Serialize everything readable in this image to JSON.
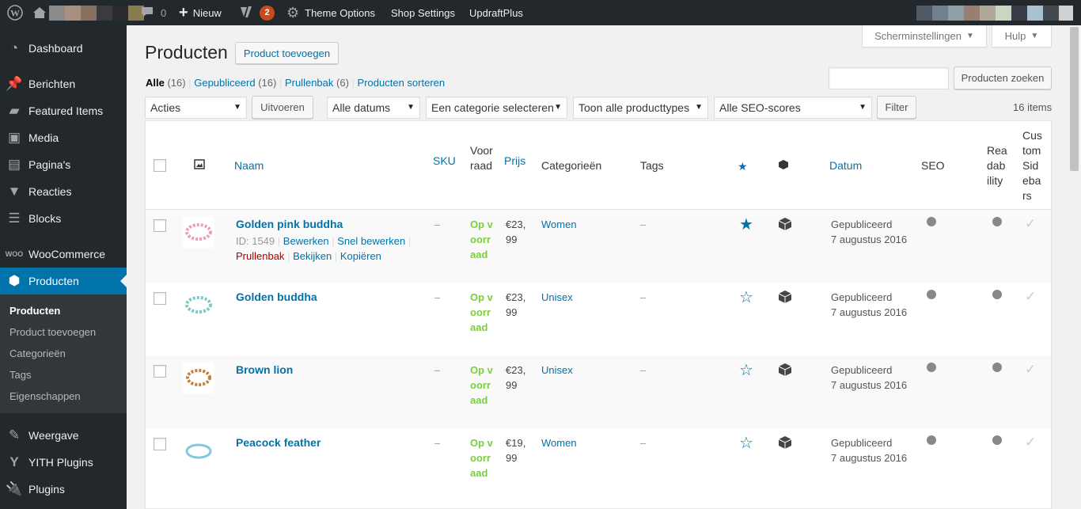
{
  "adminbar": {
    "comments_count": "0",
    "new_label": "Nieuw",
    "yoast_badge": "2",
    "theme_options": "Theme Options",
    "shop_settings": "Shop Settings",
    "updraftplus": "UpdraftPlus"
  },
  "sidebar": {
    "items": [
      {
        "label": "Dashboard",
        "icon": "dashboard-icon"
      },
      {
        "label": "Berichten",
        "icon": "pin-icon"
      },
      {
        "label": "Featured Items",
        "icon": "folder-icon"
      },
      {
        "label": "Media",
        "icon": "media-icon"
      },
      {
        "label": "Pagina's",
        "icon": "page-icon"
      },
      {
        "label": "Reacties",
        "icon": "comment-icon"
      },
      {
        "label": "Blocks",
        "icon": "blocks-icon"
      },
      {
        "label": "WooCommerce",
        "icon": "woocommerce-icon"
      },
      {
        "label": "Producten",
        "icon": "product-icon"
      },
      {
        "label": "Weergave",
        "icon": "brush-icon"
      },
      {
        "label": "YITH Plugins",
        "icon": "yith-icon"
      },
      {
        "label": "Plugins",
        "icon": "plugin-icon"
      }
    ],
    "submenu": [
      "Producten",
      "Product toevoegen",
      "Categorieën",
      "Tags",
      "Eigenschappen"
    ]
  },
  "screen_options": "Scherminstellingen",
  "help": "Hulp",
  "page_title": "Producten",
  "add_product": "Product toevoegen",
  "filters": {
    "all": "Alle",
    "all_count": "(16)",
    "published": "Gepubliceerd",
    "published_count": "(16)",
    "trash": "Prullenbak",
    "trash_count": "(6)",
    "sort": "Producten sorteren"
  },
  "search_button": "Producten zoeken",
  "search_value": "",
  "bulk_actions": "Acties",
  "apply": "Uitvoeren",
  "dates": "Alle datums",
  "category": "Een categorie selecteren",
  "product_types": "Toon alle producttypes",
  "seo_scores": "Alle SEO-scores",
  "filter": "Filter",
  "item_count": "16 items",
  "columns": {
    "name": "Naam",
    "sku": "SKU",
    "stock": "Voorraad",
    "price": "Prijs",
    "categories": "Categorieën",
    "tags": "Tags",
    "date": "Datum",
    "seo": "SEO",
    "readability": "Readability",
    "sidebars": "Custom Sidebars"
  },
  "products": [
    {
      "name": "Golden pink buddha",
      "id": "ID: 1549",
      "sku": "–",
      "stock": "Op voorraad",
      "price_top": "€23,",
      "price_bottom": "99",
      "category": "Women",
      "tags": "–",
      "featured": true,
      "status": "Gepubliceerd",
      "date": "7 augustus 2016",
      "color": "#e8a0b0"
    },
    {
      "name": "Golden buddha",
      "sku": "–",
      "stock": "Op voorraad",
      "price_top": "€23,",
      "price_bottom": "99",
      "category": "Unisex",
      "tags": "–",
      "featured": false,
      "status": "Gepubliceerd",
      "date": "7 augustus 2016",
      "color": "#7fc7c8"
    },
    {
      "name": "Brown lion",
      "sku": "–",
      "stock": "Op voorraad",
      "price_top": "€23,",
      "price_bottom": "99",
      "category": "Unisex",
      "tags": "–",
      "featured": false,
      "status": "Gepubliceerd",
      "date": "7 augustus 2016",
      "color": "#c08040"
    },
    {
      "name": "Peacock feather",
      "sku": "–",
      "stock": "Op voorraad",
      "price_top": "€19,",
      "price_bottom": "99",
      "category": "Women",
      "tags": "–",
      "featured": false,
      "status": "Gepubliceerd",
      "date": "7 augustus 2016",
      "color": "#80c8e0"
    }
  ],
  "row_actions": {
    "edit": "Bewerken",
    "quick_edit": "Snel bewerken",
    "trash": "Prullenbak",
    "view": "Bekijken",
    "copy": "Kopiëren"
  },
  "colors": {
    "accent": "#0073aa",
    "adminbar": "#23282d",
    "stock": "#7ad03a",
    "trash": "#a00"
  }
}
